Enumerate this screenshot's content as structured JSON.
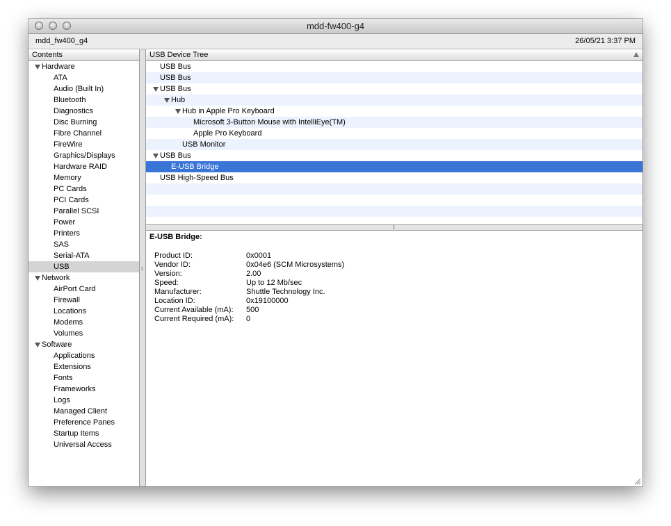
{
  "window": {
    "title": "mdd-fw400-g4"
  },
  "infobar": {
    "machine": "mdd_fw400_g4",
    "datetime": "26/05/21 3:37 PM"
  },
  "sidebar": {
    "header": "Contents",
    "groups": [
      {
        "label": "Hardware",
        "items": [
          "ATA",
          "Audio (Built In)",
          "Bluetooth",
          "Diagnostics",
          "Disc Burning",
          "Fibre Channel",
          "FireWire",
          "Graphics/Displays",
          "Hardware RAID",
          "Memory",
          "PC Cards",
          "PCI Cards",
          "Parallel SCSI",
          "Power",
          "Printers",
          "SAS",
          "Serial-ATA",
          "USB"
        ]
      },
      {
        "label": "Network",
        "items": [
          "AirPort Card",
          "Firewall",
          "Locations",
          "Modems",
          "Volumes"
        ]
      },
      {
        "label": "Software",
        "items": [
          "Applications",
          "Extensions",
          "Fonts",
          "Frameworks",
          "Logs",
          "Managed Client",
          "Preference Panes",
          "Startup Items",
          "Universal Access"
        ]
      }
    ],
    "selected": "USB"
  },
  "device_tree": {
    "header": "USB Device Tree",
    "rows": [
      {
        "label": "USB Bus"
      },
      {
        "label": "USB Bus"
      },
      {
        "label": "USB Bus"
      },
      {
        "label": "Hub"
      },
      {
        "label": "Hub in Apple Pro Keyboard"
      },
      {
        "label": "Microsoft 3-Button Mouse with IntelliEye(TM)"
      },
      {
        "label": "Apple Pro Keyboard"
      },
      {
        "label": "USB Monitor"
      },
      {
        "label": "USB Bus"
      },
      {
        "label": "E-USB Bridge"
      },
      {
        "label": "USB High-Speed Bus"
      }
    ],
    "selected": "E-USB Bridge"
  },
  "detail": {
    "title": "E-USB Bridge:",
    "fields": [
      {
        "key": "Product ID:",
        "value": "0x0001"
      },
      {
        "key": "Vendor ID:",
        "value": "0x04e6  (SCM Microsystems)"
      },
      {
        "key": "Version:",
        "value": "2.00"
      },
      {
        "key": "Speed:",
        "value": "Up to 12 Mb/sec"
      },
      {
        "key": "Manufacturer:",
        "value": "Shuttle Technology Inc."
      },
      {
        "key": "Location ID:",
        "value": "0x19100000"
      },
      {
        "key": "Current Available (mA):",
        "value": "500"
      },
      {
        "key": "Current Required (mA):",
        "value": "0"
      }
    ]
  },
  "colors": {
    "selection": "#3875d7",
    "stripe": "#edf3fe",
    "sidebar_selection": "#d4d4d4"
  }
}
